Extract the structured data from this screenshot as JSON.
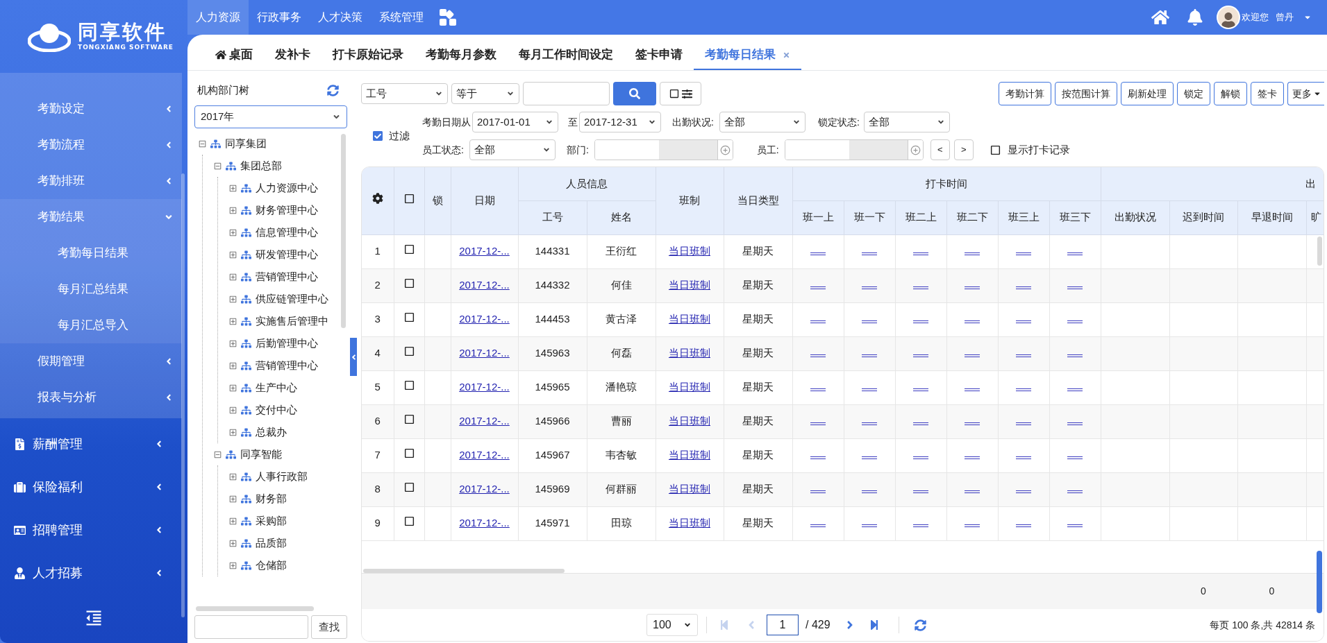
{
  "sidebar": {
    "logo": {
      "title": "同享软件",
      "subtitle": "TONGXIANG SOFTWARE"
    },
    "submenu": [
      {
        "label": "考勤设定",
        "expanded": false
      },
      {
        "label": "考勤流程",
        "expanded": false
      },
      {
        "label": "考勤排班",
        "expanded": false
      },
      {
        "label": "考勤结果",
        "expanded": true,
        "children": [
          {
            "label": "考勤每日结果"
          },
          {
            "label": "每月汇总结果"
          },
          {
            "label": "每月汇总导入"
          }
        ]
      },
      {
        "label": "假期管理",
        "expanded": false
      },
      {
        "label": "报表与分析",
        "expanded": false
      }
    ],
    "menu": [
      {
        "label": "薪酬管理",
        "kind": "salary"
      },
      {
        "label": "保险福利",
        "kind": "insurance"
      },
      {
        "label": "招聘管理",
        "kind": "hiring"
      },
      {
        "label": "人才招募",
        "kind": "talent"
      }
    ]
  },
  "topnav": [
    {
      "label": "人力资源",
      "selected": true
    },
    {
      "label": "行政事务",
      "selected": false
    },
    {
      "label": "人才决策",
      "selected": false
    },
    {
      "label": "系统管理",
      "selected": false
    }
  ],
  "user": {
    "greeting": "欢迎您",
    "name": "曾丹"
  },
  "tabs": [
    {
      "label": "桌面",
      "selected": false,
      "kind": "home",
      "closable": false
    },
    {
      "label": "发补卡",
      "selected": false,
      "kind": "page",
      "closable": false
    },
    {
      "label": "打卡原始记录",
      "selected": false,
      "kind": "page",
      "closable": false
    },
    {
      "label": "考勤每月参数",
      "selected": false,
      "kind": "page",
      "closable": false
    },
    {
      "label": "每月工作时间设定",
      "selected": false,
      "kind": "page",
      "closable": false
    },
    {
      "label": "签卡申请",
      "selected": false,
      "kind": "page",
      "closable": false
    },
    {
      "label": "考勤每日结果",
      "selected": true,
      "kind": "page",
      "closable": true
    }
  ],
  "tree": {
    "title": "机构部门树",
    "year": "2017年",
    "search_button": "查找",
    "nodes": [
      {
        "label": "同享集团",
        "expanded": true,
        "children": [
          {
            "label": "集团总部",
            "expanded": true,
            "children": [
              {
                "label": "人力资源中心",
                "expanded": false
              },
              {
                "label": "财务管理中心",
                "expanded": false
              },
              {
                "label": "信息管理中心",
                "expanded": false
              },
              {
                "label": "研发管理中心",
                "expanded": false
              },
              {
                "label": "营销管理中心",
                "expanded": false
              },
              {
                "label": "供应链管理中心",
                "expanded": false
              },
              {
                "label": "实施售后管理中",
                "expanded": false
              },
              {
                "label": "后勤管理中心",
                "expanded": false
              },
              {
                "label": "营销管理中心",
                "expanded": false
              },
              {
                "label": "生产中心",
                "expanded": false
              },
              {
                "label": "交付中心",
                "expanded": false
              },
              {
                "label": "总裁办",
                "expanded": false
              }
            ]
          },
          {
            "label": "同享智能",
            "expanded": true,
            "children": [
              {
                "label": "人事行政部",
                "expanded": false
              },
              {
                "label": "财务部",
                "expanded": false
              },
              {
                "label": "采购部",
                "expanded": false
              },
              {
                "label": "品质部",
                "expanded": false
              },
              {
                "label": "仓储部",
                "expanded": false
              }
            ]
          }
        ]
      }
    ]
  },
  "toolbar": {
    "field": "工号",
    "operator": "等于",
    "advanced": false,
    "buttons": [
      "考勤计算",
      "按范围计算",
      "刷新处理",
      "锁定",
      "解锁",
      "签卡"
    ],
    "more": "更多"
  },
  "filter": {
    "label": "过滤",
    "enabled": true,
    "date_from_label": "考勤日期从",
    "date_from": "2017-01-01",
    "date_to_label": "至",
    "date_to": "2017-12-31",
    "attendance_label": "出勤状况:",
    "attendance": "全部",
    "lock_label": "锁定状态:",
    "lock": "全部",
    "emp_status_label": "员工状态:",
    "emp_status": "全部",
    "dept_label": "部门:",
    "employee_label": "员工:",
    "prev": "<",
    "next": ">",
    "show_punch_label": "显示打卡记录",
    "show_punch": false
  },
  "table": {
    "select_all": false,
    "lock_header": "锁",
    "date_header": "日期",
    "person_group": "人员信息",
    "person_columns": [
      "工号",
      "姓名"
    ],
    "shift_header": "班制",
    "day_type_header": "当日类型",
    "punch_group": "打卡时间",
    "punch_columns": [
      "班一上",
      "班一下",
      "班二上",
      "班二下",
      "班三上",
      "班三下"
    ],
    "result_group": "出",
    "result_columns": [
      "出勤状况",
      "迟到时间",
      "早退时间",
      "旷"
    ],
    "rows": [
      {
        "no": "1",
        "checked": false,
        "date": "2017-12-...",
        "id": "144331",
        "name": "王衍红",
        "shift": "当日班制",
        "day_type": "星期天"
      },
      {
        "no": "2",
        "checked": false,
        "date": "2017-12-...",
        "id": "144332",
        "name": "何佳",
        "shift": "当日班制",
        "day_type": "星期天"
      },
      {
        "no": "3",
        "checked": false,
        "date": "2017-12-...",
        "id": "144453",
        "name": "黄古泽",
        "shift": "当日班制",
        "day_type": "星期天"
      },
      {
        "no": "4",
        "checked": false,
        "date": "2017-12-...",
        "id": "145963",
        "name": "何磊",
        "shift": "当日班制",
        "day_type": "星期天"
      },
      {
        "no": "5",
        "checked": false,
        "date": "2017-12-...",
        "id": "145965",
        "name": "潘艳琼",
        "shift": "当日班制",
        "day_type": "星期天"
      },
      {
        "no": "6",
        "checked": false,
        "date": "2017-12-...",
        "id": "145966",
        "name": "曹丽",
        "shift": "当日班制",
        "day_type": "星期天"
      },
      {
        "no": "7",
        "checked": false,
        "date": "2017-12-...",
        "id": "145967",
        "name": "韦杏敏",
        "shift": "当日班制",
        "day_type": "星期天"
      },
      {
        "no": "8",
        "checked": false,
        "date": "2017-12-...",
        "id": "145969",
        "name": "何群丽",
        "shift": "当日班制",
        "day_type": "星期天"
      },
      {
        "no": "9",
        "checked": false,
        "date": "2017-12-...",
        "id": "145971",
        "name": "田琼",
        "shift": "当日班制",
        "day_type": "星期天"
      }
    ],
    "summary": {
      "late": "0",
      "early": "0"
    }
  },
  "pagination": {
    "page_size": "100",
    "page": "1",
    "total_pages": "/ 429",
    "info": "每页 100 条,共 42814 条"
  }
}
